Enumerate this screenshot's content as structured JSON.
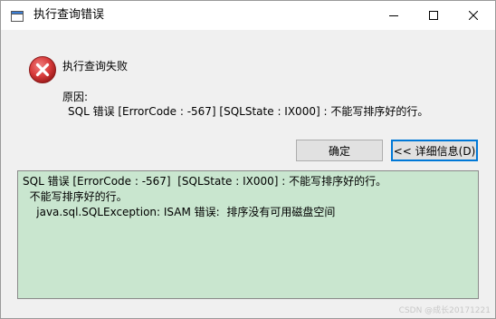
{
  "window": {
    "title": "执行查询错误",
    "controls": {
      "minimize": "minimize",
      "maximize": "maximize",
      "close": "close"
    }
  },
  "message": {
    "headline": "执行查询失败",
    "reason_label": "原因:",
    "reason_text": "SQL 错误 [ErrorCode : -567]  [SQLState : IX000] : 不能写排序好的行。"
  },
  "buttons": {
    "ok_label": "确定",
    "details_label": "<< 详细信息(D)"
  },
  "details": {
    "lines": [
      "SQL 错误 [ErrorCode : -567]  [SQLState : IX000] : 不能写排序好的行。",
      "  不能写排序好的行。",
      "    java.sql.SQLException: ISAM 错误:  排序没有可用磁盘空间"
    ]
  },
  "watermark": "CSDN @成长20171221",
  "colors": {
    "details_bg": "#c9e6cf",
    "error_red": "#d83b3b",
    "focus_blue": "#0078d7"
  },
  "icons": [
    "app-window-icon",
    "error-x-icon",
    "minimize-icon",
    "maximize-icon",
    "close-icon"
  ]
}
